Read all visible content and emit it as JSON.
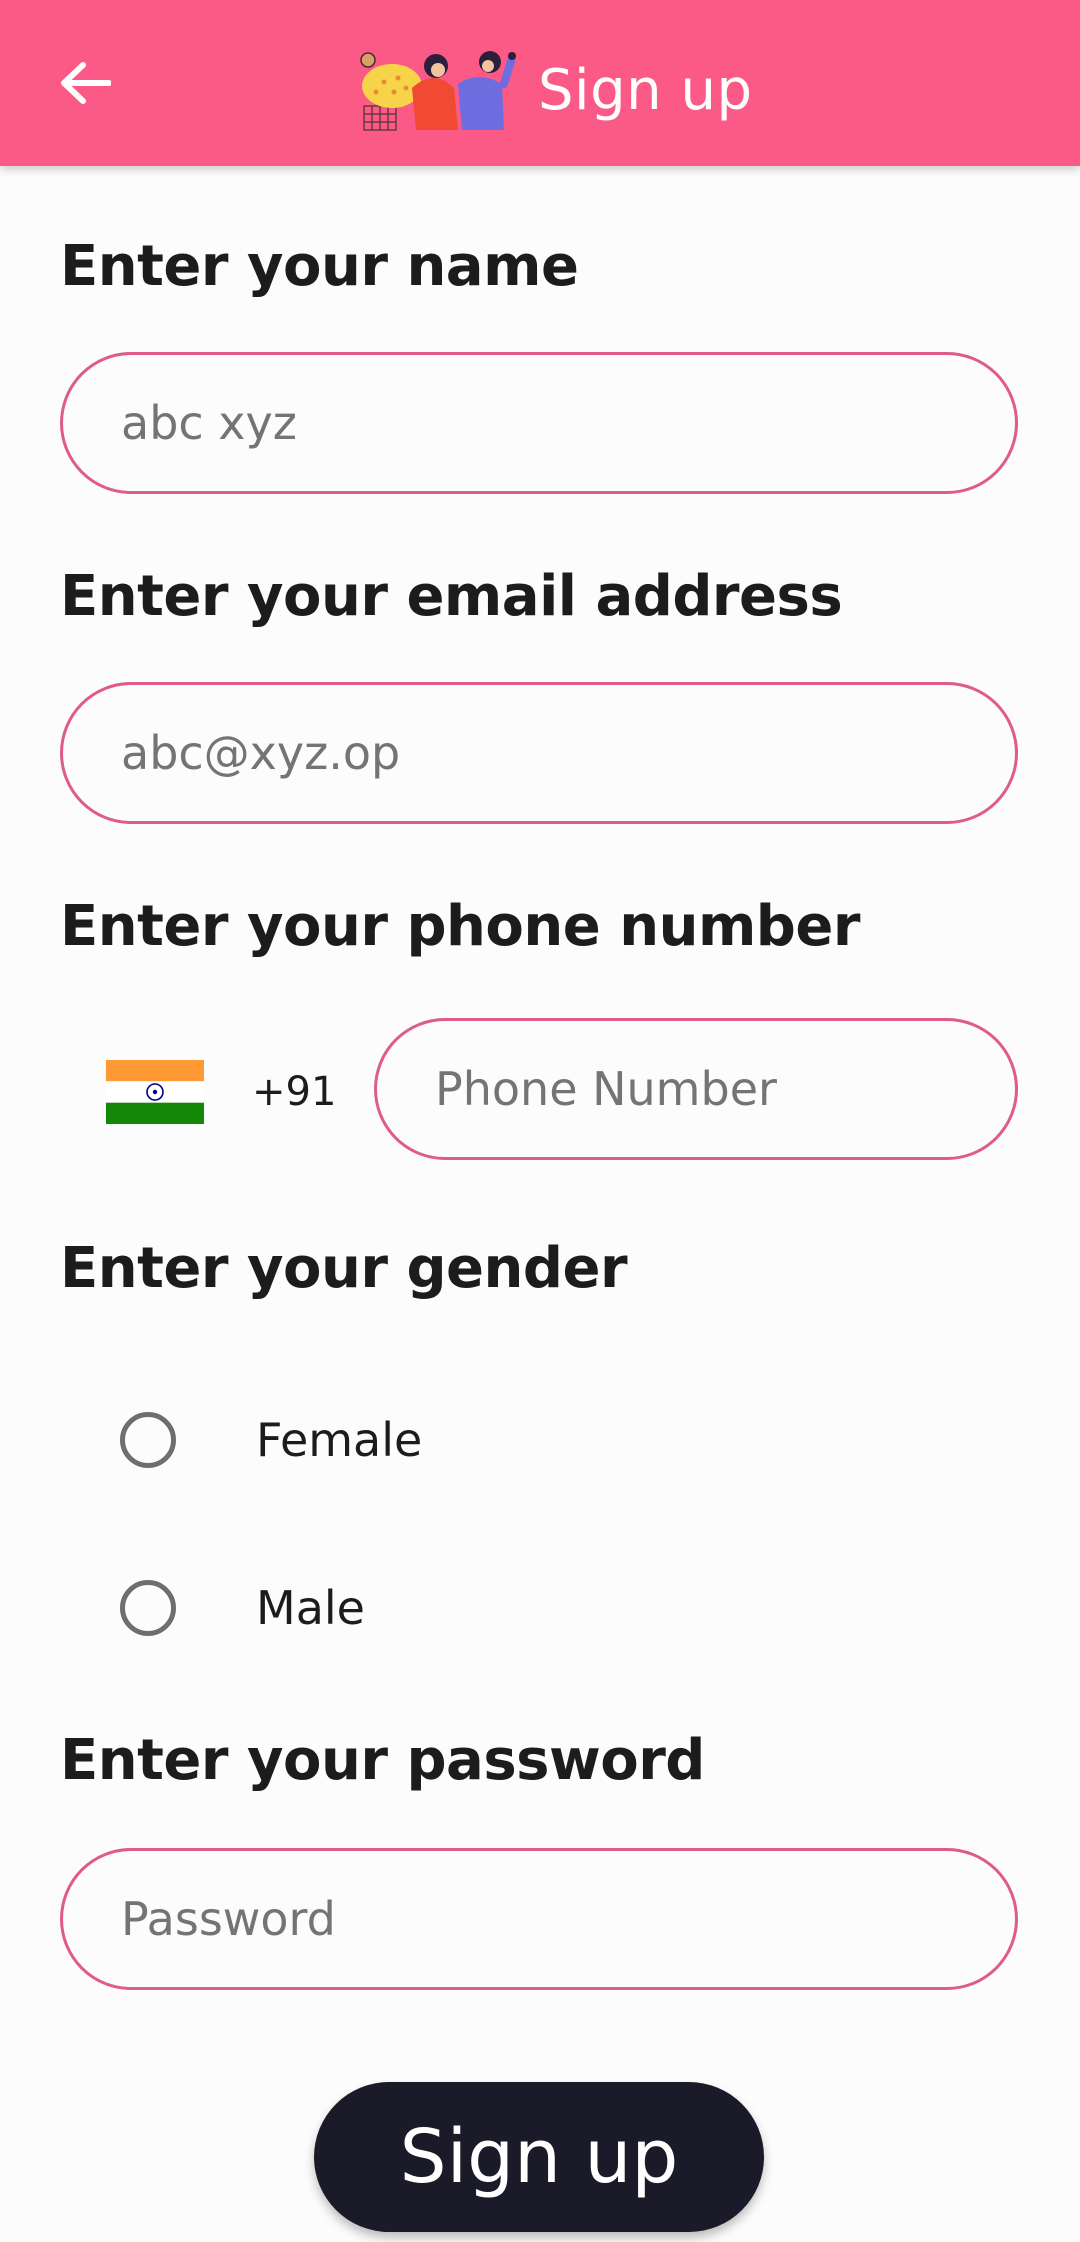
{
  "appbar": {
    "title": "Sign up",
    "back_icon": "arrow-left-icon",
    "logo_icon": "people-illustration-icon",
    "background": "#FB5A86"
  },
  "form": {
    "name": {
      "label": "Enter your name",
      "placeholder": "abc xyz"
    },
    "email": {
      "label": "Enter your email address",
      "placeholder": "abc@xyz.op"
    },
    "phone": {
      "label": "Enter your phone number",
      "country_flag_icon": "india-flag-icon",
      "country_code": "+91",
      "placeholder": "Phone Number"
    },
    "gender": {
      "label": "Enter your gender",
      "options": [
        "Female",
        "Male"
      ]
    },
    "password": {
      "label": "Enter your password",
      "placeholder": "Password"
    },
    "submit_label": "Sign up"
  },
  "colors": {
    "accent": "#FB5A86",
    "field_border": "#DE5B8A",
    "button": "#1B1A28"
  }
}
